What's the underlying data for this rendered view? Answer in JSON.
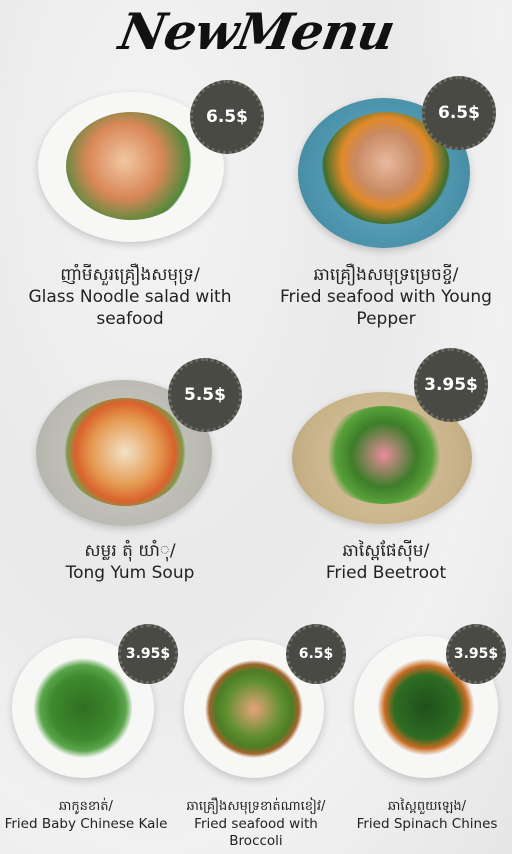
{
  "title": "NewMenu",
  "dishes": [
    {
      "price": "6.5$",
      "khmer": "ញាំមីសួរគ្រឿងសមុទ្រ/",
      "english": "Glass Noodle salad with seafood"
    },
    {
      "price": "6.5$",
      "khmer": "ឆាគ្រឿងសមុទ្រម្រេចខ្ចី/",
      "english": "Fried seafood with Young Pepper"
    },
    {
      "price": "5.5$",
      "khmer": "សម្លរ តុំ យាំុ/",
      "english": "Tong Yum Soup"
    },
    {
      "price": "3.95$",
      "khmer": "ឆាស្ពៃផែស៊ីម/",
      "english": "Fried Beetroot"
    },
    {
      "price": "3.95$",
      "khmer": "ឆាកូនខាត់/",
      "english": "Fried Baby Chinese Kale"
    },
    {
      "price": "6.5$",
      "khmer": "ឆាគ្រឿងសមុទ្រខាត់ណាខៀវ/",
      "english": "Fried seafood with Broccoli"
    },
    {
      "price": "3.95$",
      "khmer": "ឆាស្ពៃពួយឡេង/",
      "english": "Fried Spinach Chines"
    }
  ],
  "colors": {
    "price_badge": "#4a4a44",
    "text": "#222222",
    "background": "#ececec"
  }
}
